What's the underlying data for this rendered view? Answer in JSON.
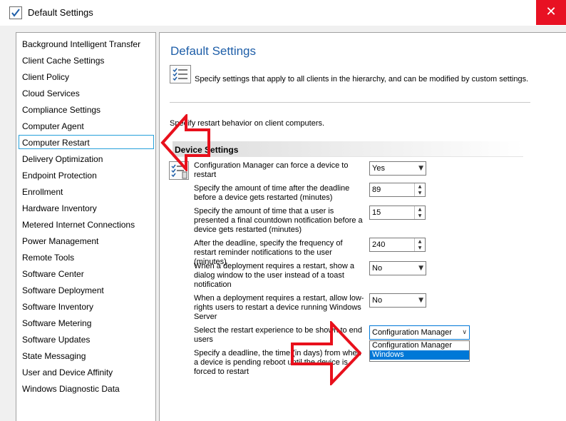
{
  "window": {
    "title": "Default Settings",
    "close_label": "✕"
  },
  "nav": {
    "items": [
      "Background Intelligent Transfer",
      "Client Cache Settings",
      "Client Policy",
      "Cloud Services",
      "Compliance Settings",
      "Computer Agent",
      "Computer Restart",
      "Delivery Optimization",
      "Endpoint Protection",
      "Enrollment",
      "Hardware Inventory",
      "Metered Internet Connections",
      "Power Management",
      "Remote Tools",
      "Software Center",
      "Software Deployment",
      "Software Inventory",
      "Software Metering",
      "Software Updates",
      "State Messaging",
      "User and Device Affinity",
      "Windows Diagnostic Data"
    ],
    "selected": "Computer Restart"
  },
  "main": {
    "title": "Default Settings",
    "description": "Specify settings that apply to all clients in the hierarchy, and can be modified by custom settings.",
    "sub_description": "Specify restart behavior on client computers.",
    "section": "Device Settings",
    "settings": [
      {
        "label": "Configuration Manager can force a device to restart",
        "value": "Yes"
      },
      {
        "label": "Specify the amount of time after the deadline before a device gets restarted (minutes)",
        "value": "89"
      },
      {
        "label": "Specify the amount of time that a user is presented a final countdown notification before a device gets restarted (minutes)",
        "value": "15"
      },
      {
        "label": "After the deadline, specify the frequency of restart reminder notifications to the user (minutes)",
        "value": "240"
      },
      {
        "label": "When a deployment requires a restart, show a dialog window to the user instead of a toast notification",
        "value": "No"
      },
      {
        "label": "When a deployment requires a restart, allow low-rights users to restart a device running Windows Server",
        "value": "No"
      },
      {
        "label": "Select the restart experience to be shown to end users",
        "value": "Configuration Manager"
      },
      {
        "label": "Specify a deadline, the time (in days) from when a device is pending reboot until the device is forced to restart",
        "value": ""
      }
    ],
    "dropdown_options": [
      "Configuration Manager",
      "Windows"
    ],
    "dropdown_highlighted": "Windows"
  },
  "colors": {
    "accent": "#0078d7",
    "title_blue": "#1e5ea8",
    "close_red": "#e81123",
    "annotation_red": "#e8101c"
  }
}
